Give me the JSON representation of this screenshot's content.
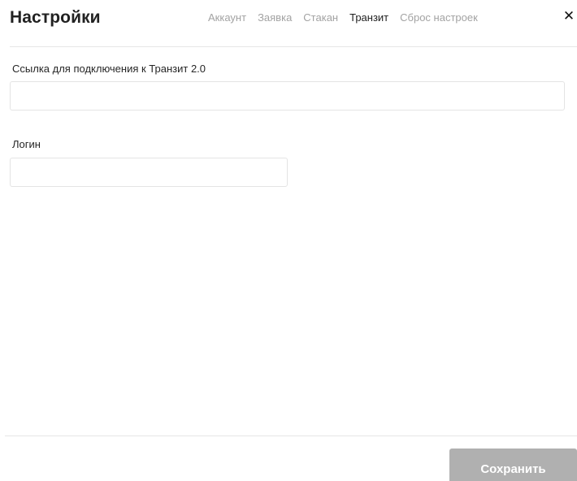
{
  "dialog": {
    "title": "Настройки",
    "tabs": [
      {
        "label": "Аккаунт",
        "active": false
      },
      {
        "label": "Заявка",
        "active": false
      },
      {
        "label": "Стакан",
        "active": false
      },
      {
        "label": "Транзит",
        "active": true
      },
      {
        "label": "Сброс настроек",
        "active": false
      }
    ],
    "close_icon": "close-icon",
    "close_glyph": "✕"
  },
  "form": {
    "connection_url": {
      "label": "Ссылка для подключения к Транзит 2.0",
      "value": "",
      "placeholder": ""
    },
    "login": {
      "label": "Логин",
      "value": "",
      "placeholder": ""
    }
  },
  "footer": {
    "save_label": "Сохранить"
  },
  "colors": {
    "tab_inactive": "#a3a3a3",
    "tab_active": "#1f1f1f",
    "save_button_disabled": "#b0b0b0",
    "divider": "#e6e6e6"
  }
}
